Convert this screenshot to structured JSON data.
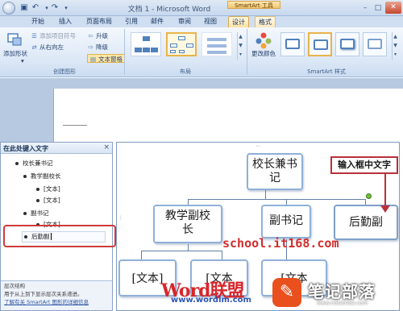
{
  "window": {
    "title": "文档 1 - Microsoft Word",
    "contextual_group": "SmartArt 工具",
    "controls": {
      "minimize": "–",
      "maximize": "□",
      "close": "✕"
    }
  },
  "tabs": [
    "开始",
    "插入",
    "页面布局",
    "引用",
    "邮件",
    "审阅",
    "视图",
    "设计",
    "格式"
  ],
  "ribbon": {
    "create_graphic": {
      "add_shape": "添加形状",
      "add_bullet": "添加项目符号",
      "right_to_left": "从右向左",
      "promote": "升级",
      "demote": "降级",
      "text_pane": "文本窗格",
      "group_label": "创建图形"
    },
    "layouts": {
      "group_label": "布局"
    },
    "styles": {
      "change_colors": "更改颜色",
      "group_label": "SmartArt 样式"
    }
  },
  "text_pane": {
    "title": "在此处键入文字",
    "close": "×",
    "items": [
      {
        "text": "校长兼书记",
        "level": 1
      },
      {
        "text": "教学副校长",
        "level": 2
      },
      {
        "text": "[文本]",
        "level": 3
      },
      {
        "text": "[文本]",
        "level": 3
      },
      {
        "text": "副书记",
        "level": 2
      },
      {
        "text": "[文本]",
        "level": 3
      },
      {
        "text": "后勤副",
        "level": 2
      }
    ],
    "footer": {
      "line1": "层次结构",
      "line2": "用于从上到下显示层次关系递进。",
      "link": "了解有关 SmartArt 图形的详细信息"
    }
  },
  "smartart": {
    "nodes": {
      "root": "校长兼书\n记",
      "child1": "教学副校\n长",
      "child2": "副书记",
      "child3": "后勤副",
      "leaf1": "[文本]",
      "leaf2": "[文本",
      "leaf3": "[文本"
    }
  },
  "annotation": {
    "callout": "输入框中文字"
  },
  "watermarks": {
    "school": "school.it168.com",
    "word_logo": "Word联盟",
    "word_url": "www.wordlm.com",
    "notetribe_name": "笔记部落",
    "notetribe_url": "www.notetribe.com"
  },
  "colors": {
    "accent_blue": "#4f81bd",
    "highlight_red": "#cf3b3b",
    "contextual_orange": "#f2c56c"
  }
}
